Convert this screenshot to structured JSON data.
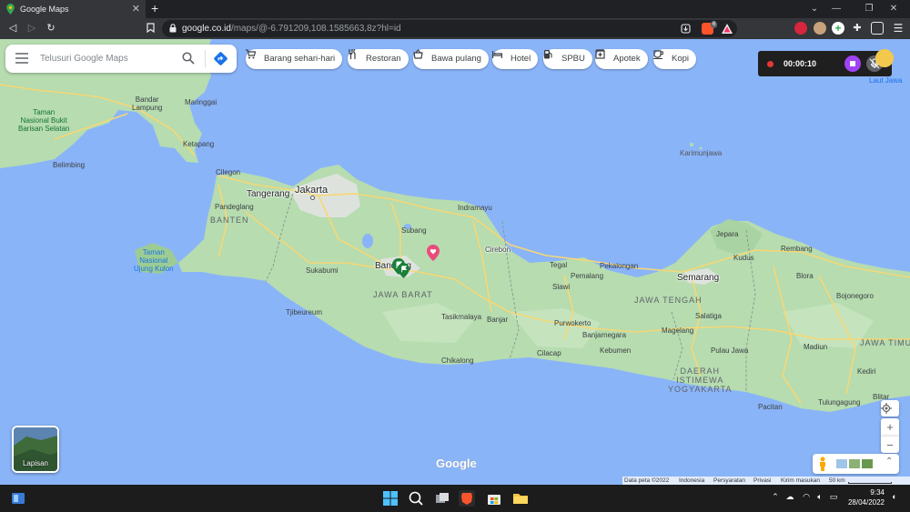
{
  "browser": {
    "tab_title": "Google Maps",
    "new_tab": "+",
    "url_host": "google.co.id",
    "url_path": "/maps/@-6.791209,108.1585663,8z?hl=id",
    "brave_badge": "6"
  },
  "search": {
    "placeholder": "Telusuri Google Maps"
  },
  "chips": [
    {
      "label": "Barang sehari-hari",
      "icon": "cart-icon"
    },
    {
      "label": "Restoran",
      "icon": "fork-knife-icon"
    },
    {
      "label": "Bawa pulang",
      "icon": "takeout-icon"
    },
    {
      "label": "Hotel",
      "icon": "bed-icon"
    },
    {
      "label": "SPBU",
      "icon": "fuel-icon"
    },
    {
      "label": "Apotek",
      "icon": "pharmacy-icon"
    },
    {
      "label": "Kopi",
      "icon": "coffee-icon"
    }
  ],
  "recorder": {
    "time": "00:00:10"
  },
  "layers": {
    "label": "Lapisan"
  },
  "map": {
    "labels": {
      "bandar_lampung": "Bandar\nLampung",
      "maringgai": "Maringgai",
      "taman_bukit": "Taman\nNasional Bukit\nBarisan Selatan",
      "ketapang": "Ketapang",
      "belimbing": "Belimbing",
      "cilegon": "Cilegon",
      "tangerang": "Tangerang",
      "jakarta": "Jakarta",
      "pandeglang": "Pandeglang",
      "banten": "BANTEN",
      "indramayu": "Indramayu",
      "subang": "Subang",
      "cirebon": "Cirebon",
      "taman_ujung_kulon": "Taman\nNasional\nUjung Kulon",
      "sukabumi": "Sukabumi",
      "bandung": "Bandung",
      "jawa_barat": "JAWA BARAT",
      "tasikmalaya": "Tasikmalaya",
      "banjar": "Banjar",
      "tjibeureum": "Tjibeureum",
      "chikalong": "Chikalong",
      "tegal": "Tegal",
      "pekalongan": "Pekalongan",
      "pemalang": "Pemalang",
      "slawi": "Slawi",
      "purwokerto": "Purwokerto",
      "banjarnegara": "Banjarnegara",
      "cilacap": "Cilacap",
      "kebumen": "Kebumen",
      "jawa_tengah": "JAWA TENGAH",
      "magelang": "Magelang",
      "salatiga": "Salatiga",
      "semarang": "Semarang",
      "kudus": "Kudus",
      "jepara": "Jepara",
      "rembang": "Rembang",
      "blora": "Blora",
      "bojonegoro": "Bojonegoro",
      "pulau_jawa": "Pulau Jawa",
      "daerah_istimewa": "DAERAH\nISTIMEWA\nYOGYAKARTA",
      "madiun": "Madiun",
      "jawa_timur": "JAWA TIMU",
      "kediri": "Kediri",
      "blitar": "Blitar",
      "pacitan": "Pacitan",
      "tulungagung": "Tulungagung",
      "karimunjawa": "Karimunjawa",
      "laut_jawa": "Laut Jawa"
    }
  },
  "google_logo": "Google",
  "attribution": {
    "data": "Data peta ©2022",
    "country": "Indonesia",
    "terms": "Persyaratan",
    "privacy": "Privasi",
    "feedback": "Kirim masukan",
    "scale": "50 km"
  },
  "taskbar": {
    "time": "9:34",
    "date": "28/04/2022"
  },
  "colors": {
    "land": "#b6dcb0",
    "land_light": "#cde8c4",
    "water": "#8ab4f8",
    "urban": "#e8e8e8",
    "road": "#f7d774",
    "pin_red": "#ea4c7a",
    "pin_green": "#188038"
  }
}
